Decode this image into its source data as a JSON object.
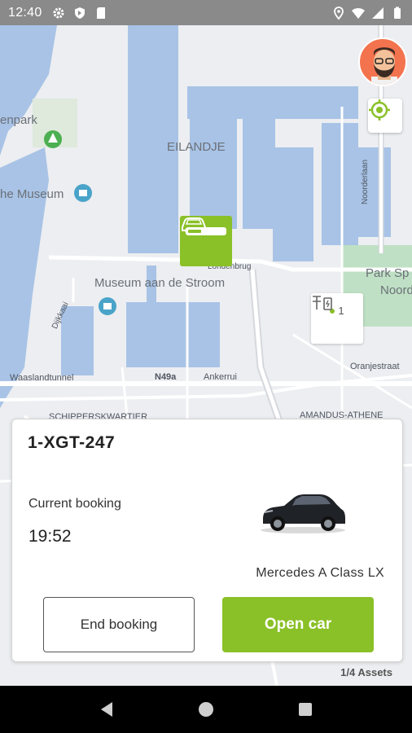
{
  "status_bar": {
    "time": "12:40",
    "left_icons": [
      "gear-icon",
      "shield-icon",
      "sd-card-icon"
    ],
    "right_icons": [
      "location-icon",
      "wifi-icon",
      "signal-icon",
      "battery-icon"
    ]
  },
  "map": {
    "labels": {
      "eilandje": "EILANDJE",
      "park": "enpark",
      "museum_left": "he Museum",
      "museum_stroom": "Museum aan de Stroom",
      "park_right": "Park Sp",
      "noord": "Noord",
      "waaslandtunnel": "Waaslandtunnel",
      "n49a": "N49a",
      "ankerrui": "Ankerrui",
      "oranjestraat": "Oranjestraat",
      "schippers": "SCHIPPERSKWARTIER",
      "amandus": "AMANDUS-ATHENE",
      "noorderlaan": "Noorderlaan",
      "londenbrug": "Londenbrug",
      "dijkkaai": "Dijkkaai"
    },
    "car_marker": {
      "icon": "car-icon",
      "battery_level": 0.35
    },
    "station_marker": {
      "icon": "charging-station-icon",
      "count": "1"
    },
    "avatar_icon": "avatar-bearded-man-icon",
    "locate_icon": "crosshair-icon"
  },
  "booking": {
    "plate": "1-XGT-247",
    "current_label": "Current booking",
    "time": "19:52",
    "car_name": "Mercedes A Class LX",
    "end_button": "End booking",
    "open_button": "Open car"
  },
  "assets_label": "1/4 Assets",
  "nav_bar": {
    "icons": [
      "back-icon",
      "home-icon",
      "recents-icon"
    ]
  },
  "colors": {
    "accent": "#8ac028",
    "status_bar": "#8a8a8a",
    "water": "#a8c3e6",
    "park": "#bfe0c4"
  }
}
